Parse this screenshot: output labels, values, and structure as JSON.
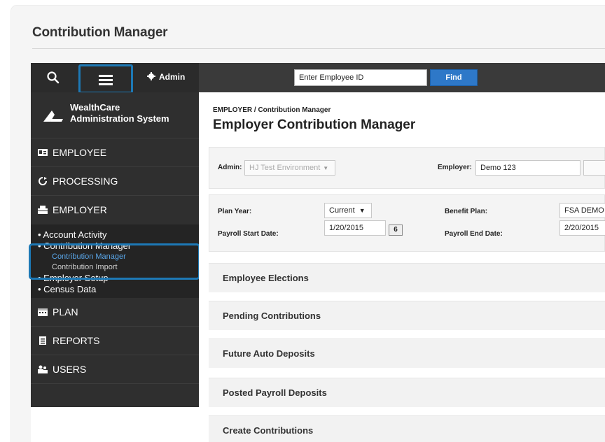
{
  "doc": {
    "title": "Contribution Manager"
  },
  "topbar": {
    "admin_label": "Admin",
    "employee_id_placeholder": "Enter Employee ID",
    "find_label": "Find"
  },
  "brand": {
    "line1": "WealthCare",
    "line2": "Administration System"
  },
  "sidebar": {
    "items": [
      {
        "label": "EMPLOYEE",
        "icon": "id-card-icon"
      },
      {
        "label": "PROCESSING",
        "icon": "refresh-icon"
      },
      {
        "label": "EMPLOYER",
        "icon": "building-icon"
      }
    ],
    "employer_sub": [
      {
        "label": "• Account Activity"
      },
      {
        "label": "• Contribution Manager"
      }
    ],
    "contribution_sub": [
      {
        "label": "Contribution Manager",
        "active": true
      },
      {
        "label": "Contribution Import",
        "active": false
      }
    ],
    "employer_sub2": [
      {
        "label": "• Employer Setup"
      },
      {
        "label": "• Census Data"
      }
    ],
    "items_bottom": [
      {
        "label": "PLAN",
        "icon": "calendar-icon"
      },
      {
        "label": "REPORTS",
        "icon": "report-icon"
      },
      {
        "label": "USERS",
        "icon": "users-icon"
      }
    ]
  },
  "main": {
    "breadcrumb": "EMPLOYER / Contribution Manager",
    "title": "Employer Contribution Manager",
    "admin_label": "Admin:",
    "admin_value": "HJ Test Environment",
    "employer_label": "Employer:",
    "employer_value": "Demo 123",
    "plan_year_label": "Plan Year:",
    "plan_year_value": "Current",
    "benefit_plan_label": "Benefit Plan:",
    "benefit_plan_value": "FSA DEMO",
    "payroll_start_label": "Payroll Start Date:",
    "payroll_start_value": "1/20/2015",
    "calendar_button": "6",
    "payroll_end_label": "Payroll End Date:",
    "payroll_end_value": "2/20/2015",
    "sections": [
      "Employee Elections",
      "Pending Contributions",
      "Future Auto Deposits",
      "Posted Payroll Deposits",
      "Create Contributions"
    ]
  },
  "colors": {
    "highlight": "#1d79b6",
    "find_button": "#2e78c8",
    "active_link": "#5aa7ea"
  }
}
